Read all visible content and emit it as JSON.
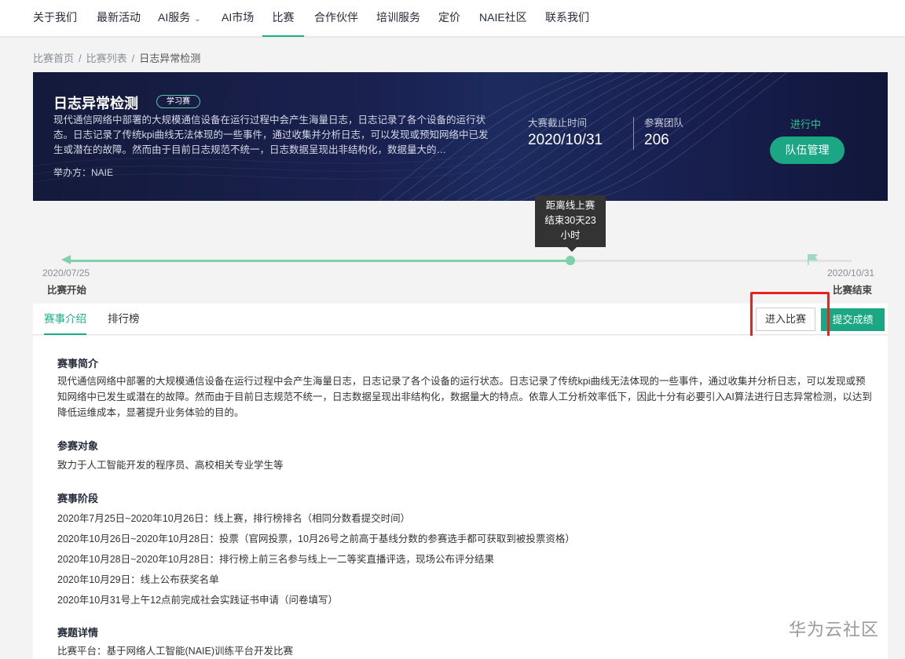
{
  "nav": {
    "items": [
      "关于我们",
      "最新活动",
      "AI服务",
      "AI市场",
      "比赛",
      "合作伙伴",
      "培训服务",
      "定价",
      "NAIE社区",
      "联系我们"
    ],
    "active": "比赛"
  },
  "breadcrumb": [
    "比赛首页",
    "比赛列表",
    "日志异常检测"
  ],
  "banner": {
    "title": "日志异常检测",
    "badge": "学习赛",
    "description": "现代通信网络中部署的大规模通信设备在运行过程中会产生海量日志，日志记录了各个设备的运行状态。日志记录了传统kpi曲线无法体现的一些事件，通过收集并分析日志，可以发现或预知网络中已发生或潜在的故障。然而由于目前日志规范不统一，日志数据呈现出非结构化，数据量大的…",
    "host": "举办方：NAIE",
    "deadline_label": "大赛截止时间",
    "deadline_value": "2020/10/31",
    "teams_label": "参赛团队",
    "teams_value": "206",
    "status": "进行中",
    "team_button": "队伍管理"
  },
  "timeline": {
    "tooltip": [
      "距离线上赛",
      "结束30天23",
      "小时"
    ],
    "start_date": "2020/07/25",
    "start_label": "比赛开始",
    "end_date": "2020/10/31",
    "end_label": "比赛结束",
    "progress": 0.642
  },
  "tabs": {
    "items": [
      "赛事介绍",
      "排行榜"
    ],
    "active": "赛事介绍",
    "enter_button": "进入比赛",
    "submit_button": "提交成绩"
  },
  "content": {
    "intro_title": "赛事简介",
    "intro_text": "现代通信网络中部署的大规模通信设备在运行过程中会产生海量日志，日志记录了各个设备的运行状态。日志记录了传统kpi曲线无法体现的一些事件，通过收集并分析日志，可以发现或预知网络中已发生或潜在的故障。然而由于目前日志规范不统一，日志数据呈现出非结构化，数据量大的特点。依靠人工分析效率低下，因此十分有必要引入AI算法进行日志异常检测，以达到降低运维成本，显著提升业务体验的目的。",
    "target_title": "参赛对象",
    "target_text": "致力于人工智能开发的程序员、高校相关专业学生等",
    "stage_title": "赛事阶段",
    "stages": [
      "2020年7月25日~2020年10月26日：线上赛，排行榜排名（相同分数看提交时间）",
      "2020年10月26日~2020年10月28日：投票（官网投票，10月26号之前高于基线分数的参赛选手都可获取到被投票资格）",
      "2020年10月28日~2020年10月28日：排行榜上前三名参与线上一二等奖直播评选，现场公布评分结果",
      "2020年10月29日：线上公布获奖名单",
      "2020年10月31号上午12点前完成社会实践证书申请（问卷填写）"
    ],
    "detail_title": "赛题详情",
    "detail_text": "比赛平台：基于网络人工智能(NAIE)训练平台开发比赛"
  },
  "watermark": "华为云社区",
  "colors": {
    "accent": "#1ba784",
    "highlight": "#e62222",
    "banner_bg": "#1a2150"
  }
}
